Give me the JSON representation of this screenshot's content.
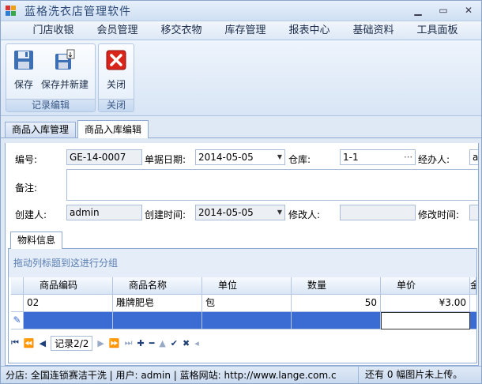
{
  "window": {
    "title": "蓝格洗衣店管理软件"
  },
  "menu": [
    "门店收银",
    "会员管理",
    "移交衣物",
    "库存管理",
    "报表中心",
    "基础资料",
    "工具面板"
  ],
  "ribbon": {
    "groups": [
      {
        "label": "记录编辑",
        "buttons": [
          {
            "label": "保存",
            "icon": "save-icon"
          },
          {
            "label": "保存并新建",
            "icon": "save-new-icon"
          }
        ]
      },
      {
        "label": "关闭",
        "buttons": [
          {
            "label": "关闭",
            "icon": "close-icon"
          }
        ]
      }
    ]
  },
  "doc_tabs": [
    "商品入库管理",
    "商品入库编辑"
  ],
  "form": {
    "code_label": "编号:",
    "code_value": "GE-14-0007",
    "date_label": "单据日期:",
    "date_value": "2014-05-05",
    "warehouse_label": "仓库:",
    "warehouse_value": "1-1",
    "handler_label": "经办人:",
    "handler_value": "a",
    "remark_label": "备注:",
    "remark_value": "",
    "creator_label": "创建人:",
    "creator_value": "admin",
    "created_label": "创建时间:",
    "created_value": "2014-05-05",
    "modifier_label": "修改人:",
    "modifier_value": "",
    "modified_label": "修改时间:"
  },
  "inner_tab": "物料信息",
  "grid": {
    "group_hint": "拖动列标题到这进行分组",
    "columns": [
      "商品编码",
      "商品名称",
      "单位",
      "数量",
      "单价",
      "金"
    ],
    "rows": [
      [
        "02",
        "雕牌肥皂",
        "包",
        "50",
        "¥3.00",
        ""
      ]
    ]
  },
  "navigator": {
    "record_label": "记录2/2"
  },
  "status": {
    "left": "分店: 全国连锁赛洁干洗 | 用户: admin  |  蓝格网站: http://www.lange.com.c",
    "right": "还有 0 幅图片未上传。"
  }
}
